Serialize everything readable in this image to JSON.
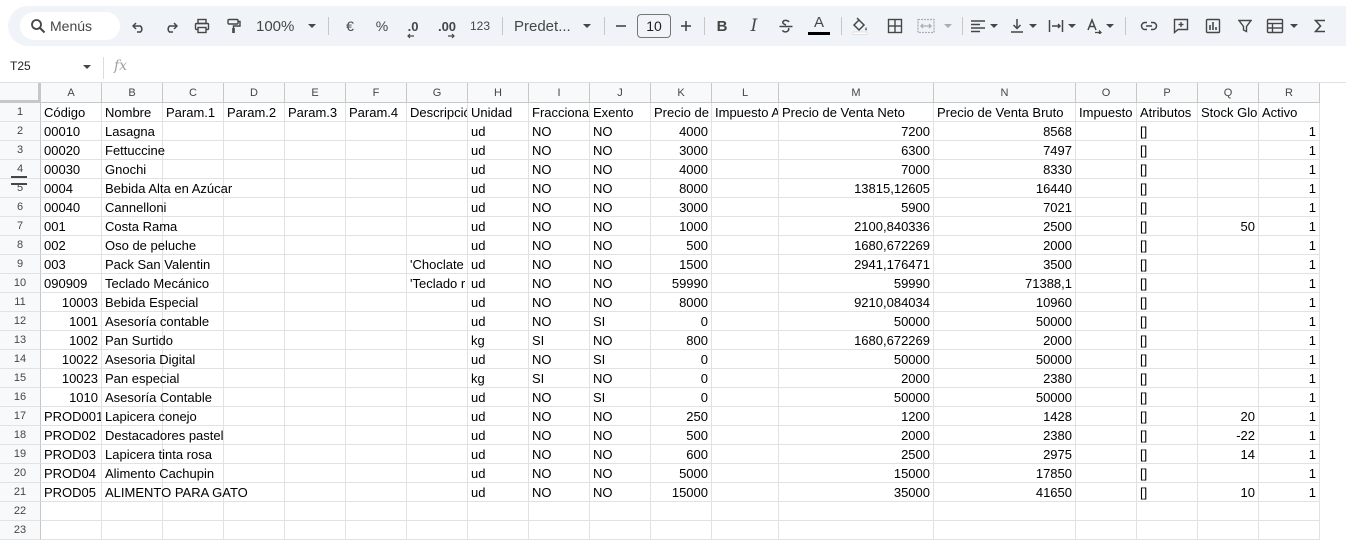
{
  "toolbar": {
    "search_label": "Menús",
    "zoom": "100%",
    "currency": "€",
    "percent": "%",
    "decimal_decrease": ".0",
    "decimal_increase": ".00",
    "number_format": "123",
    "font_name": "Predet...",
    "font_size": "10",
    "bold": "B",
    "italic": "I",
    "text_color_letter": "A",
    "text_color_bar": "#000000"
  },
  "formula_bar": {
    "name_box": "T25",
    "fx": "fx"
  },
  "columns": [
    "A",
    "B",
    "C",
    "D",
    "E",
    "F",
    "G",
    "H",
    "I",
    "J",
    "K",
    "L",
    "M",
    "N",
    "O",
    "P",
    "Q",
    "R"
  ],
  "rows": [
    {
      "n": "1",
      "cells": [
        "Código",
        "Nombre",
        "Param.1",
        "Param.2",
        "Param.3",
        "Param.4",
        "Descripción",
        "Unidad",
        "Fraccionable",
        "Exento",
        "Precio de",
        "Impuesto Adicional",
        "Precio de Venta Neto",
        "Precio de Venta Bruto",
        "Impuesto",
        "Atributos",
        "Stock Global",
        "Activo"
      ]
    },
    {
      "n": "2",
      "cells": [
        "00010",
        "Lasagna",
        "",
        "",
        "",
        "",
        "",
        "ud",
        "NO",
        "NO",
        "4000",
        "",
        "7200",
        "8568",
        "",
        "[]",
        "",
        "1"
      ]
    },
    {
      "n": "3",
      "cells": [
        "00020",
        "Fettuccine",
        "",
        "",
        "",
        "",
        "",
        "ud",
        "NO",
        "NO",
        "3000",
        "",
        "6300",
        "7497",
        "",
        "[]",
        "",
        "1"
      ]
    },
    {
      "n": "4",
      "cells": [
        "00030",
        "Gnochi",
        "",
        "",
        "",
        "",
        "",
        "ud",
        "NO",
        "NO",
        "4000",
        "",
        "7000",
        "8330",
        "",
        "[]",
        "",
        "1"
      ]
    },
    {
      "n": "5",
      "cells": [
        "0004",
        "Bebida Alta en Azúcar",
        "",
        "",
        "",
        "",
        "",
        "ud",
        "NO",
        "NO",
        "8000",
        "",
        "13815,12605",
        "16440",
        "",
        "[]",
        "",
        "1"
      ]
    },
    {
      "n": "6",
      "cells": [
        "00040",
        "Cannelloni",
        "",
        "",
        "",
        "",
        "",
        "ud",
        "NO",
        "NO",
        "3000",
        "",
        "5900",
        "7021",
        "",
        "[]",
        "",
        "1"
      ]
    },
    {
      "n": "7",
      "cells": [
        "001",
        "Costa Rama",
        "",
        "",
        "",
        "",
        "",
        "ud",
        "NO",
        "NO",
        "1000",
        "",
        "2100,840336",
        "2500",
        "",
        "[]",
        "50",
        "1"
      ]
    },
    {
      "n": "8",
      "cells": [
        "002",
        "Oso de peluche",
        "",
        "",
        "",
        "",
        "",
        "ud",
        "NO",
        "NO",
        "500",
        "",
        "1680,672269",
        "2000",
        "",
        "[]",
        "",
        "1"
      ]
    },
    {
      "n": "9",
      "cells": [
        "003",
        "Pack San Valentin",
        "",
        "",
        "",
        "",
        "'Choclate",
        "ud",
        "NO",
        "NO",
        "1500",
        "",
        "2941,176471",
        "3500",
        "",
        "[]",
        "",
        "1"
      ]
    },
    {
      "n": "10",
      "cells": [
        "090909",
        "Teclado Mecánico",
        "",
        "",
        "",
        "",
        "'Teclado r",
        "ud",
        "NO",
        "NO",
        "59990",
        "",
        "59990",
        "71388,1",
        "",
        "[]",
        "",
        "1"
      ]
    },
    {
      "n": "11",
      "cells": [
        "10003",
        "Bebida Especial",
        "",
        "",
        "",
        "",
        "",
        "ud",
        "NO",
        "NO",
        "8000",
        "",
        "9210,084034",
        "10960",
        "",
        "[]",
        "",
        "1"
      ]
    },
    {
      "n": "12",
      "cells": [
        "1001",
        "Asesoría contable",
        "",
        "",
        "",
        "",
        "",
        "ud",
        "NO",
        "SI",
        "0",
        "",
        "50000",
        "50000",
        "",
        "[]",
        "",
        "1"
      ]
    },
    {
      "n": "13",
      "cells": [
        "1002",
        "Pan Surtido",
        "",
        "",
        "",
        "",
        "",
        "kg",
        "SI",
        "NO",
        "800",
        "",
        "1680,672269",
        "2000",
        "",
        "[]",
        "",
        "1"
      ]
    },
    {
      "n": "14",
      "cells": [
        "10022",
        "Asesoria Digital",
        "",
        "",
        "",
        "",
        "",
        "ud",
        "NO",
        "SI",
        "0",
        "",
        "50000",
        "50000",
        "",
        "[]",
        "",
        "1"
      ]
    },
    {
      "n": "15",
      "cells": [
        "10023",
        "Pan especial",
        "",
        "",
        "",
        "",
        "",
        "kg",
        "SI",
        "NO",
        "0",
        "",
        "2000",
        "2380",
        "",
        "[]",
        "",
        "1"
      ]
    },
    {
      "n": "16",
      "cells": [
        "1010",
        "Asesoría Contable",
        "",
        "",
        "",
        "",
        "",
        "ud",
        "NO",
        "SI",
        "0",
        "",
        "50000",
        "50000",
        "",
        "[]",
        "",
        "1"
      ]
    },
    {
      "n": "17",
      "cells": [
        "PROD001",
        "Lapicera conejo",
        "",
        "",
        "",
        "",
        "",
        "ud",
        "NO",
        "NO",
        "250",
        "",
        "1200",
        "1428",
        "",
        "[]",
        "20",
        "1"
      ]
    },
    {
      "n": "18",
      "cells": [
        "PROD02",
        "Destacadores pastel",
        "",
        "",
        "",
        "",
        "",
        "ud",
        "NO",
        "NO",
        "500",
        "",
        "2000",
        "2380",
        "",
        "[]",
        "-22",
        "1"
      ]
    },
    {
      "n": "19",
      "cells": [
        "PROD03",
        "Lapicera tinta rosa",
        "",
        "",
        "",
        "",
        "",
        "ud",
        "NO",
        "NO",
        "600",
        "",
        "2500",
        "2975",
        "",
        "[]",
        "14",
        "1"
      ]
    },
    {
      "n": "20",
      "cells": [
        "PROD04",
        "Alimento Cachupin",
        "",
        "",
        "",
        "",
        "",
        "ud",
        "NO",
        "NO",
        "5000",
        "",
        "15000",
        "17850",
        "",
        "[]",
        "",
        "1"
      ]
    },
    {
      "n": "21",
      "cells": [
        "PROD05",
        "ALIMENTO PARA GATO",
        "",
        "",
        "",
        "",
        "",
        "ud",
        "NO",
        "NO",
        "15000",
        "",
        "35000",
        "41650",
        "",
        "[]",
        "10",
        "1"
      ]
    },
    {
      "n": "22",
      "cells": [
        "",
        "",
        "",
        "",
        "",
        "",
        "",
        "",
        "",
        "",
        "",
        "",
        "",
        "",
        "",
        "",
        "",
        ""
      ]
    },
    {
      "n": "23",
      "cells": [
        "",
        "",
        "",
        "",
        "",
        "",
        "",
        "",
        "",
        "",
        "",
        "",
        "",
        "",
        "",
        "",
        "",
        ""
      ]
    }
  ]
}
